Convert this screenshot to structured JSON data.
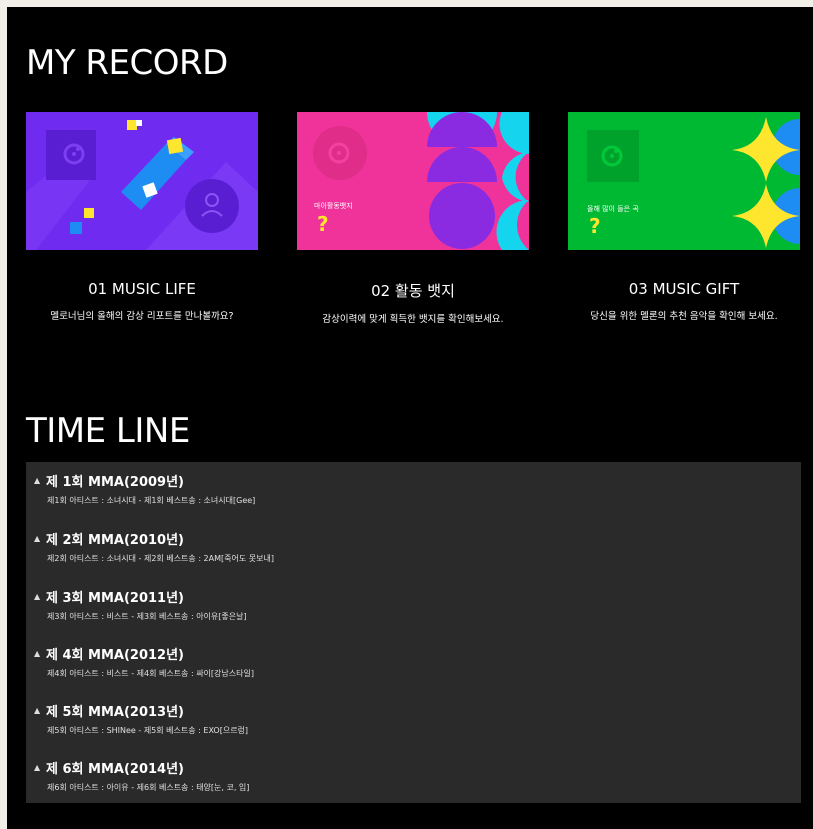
{
  "my_record": {
    "title": "MY RECORD",
    "cards": [
      {
        "title": "01 MUSIC LIFE",
        "desc": "멜로너님의 올해의 감상 리포트를 만나볼까요?"
      },
      {
        "title": "02 활동 뱃지",
        "desc": "감상이력에 맞게 획득한 뱃지를 확인해보세요.",
        "overlay_label": "마이활동뱃지",
        "overlay_mark": "?"
      },
      {
        "title": "03 MUSIC GIFT",
        "desc": "당신을 위한 멜론의 추천 음악을 확인해 보세요.",
        "overlay_label": "올해 많이 들은 곡",
        "overlay_mark": "?"
      }
    ],
    "colors": {
      "card1": "#6f2cf0",
      "card2": "#f0339a",
      "card3": "#00b933",
      "accent_yellow": "#ffe62e",
      "accent_blue": "#1d8cf3",
      "accent_cyan": "#15d4ee"
    }
  },
  "timeline": {
    "title": "TIME LINE",
    "items": [
      {
        "title": "제 1회 MMA(2009년)",
        "detail": "제1회 아티스트 : 소녀시대 - 제1회 베스트송 : 소녀시대[Gee]"
      },
      {
        "title": "제 2회 MMA(2010년)",
        "detail": "제2회 아티스트 : 소녀시대 - 제2회 베스트송 : 2AM[죽어도 못보내]"
      },
      {
        "title": "제 3회 MMA(2011년)",
        "detail": "제3회 아티스트 : 비스트 - 제3회 베스트송 : 아이유[좋은날]"
      },
      {
        "title": "제 4회 MMA(2012년)",
        "detail": "제4회 아티스트 : 비스트 - 제4회 베스트송 : 싸이[강남스타일]"
      },
      {
        "title": "제 5회 MMA(2013년)",
        "detail": "제5회 아티스트 : SHINee - 제5회 베스트송 : EXO[으르렁]"
      },
      {
        "title": "제 6회 MMA(2014년)",
        "detail": "제6회 아티스트 : 아이유 - 제6회 베스트송 : 태양[눈, 코, 입]"
      }
    ]
  }
}
